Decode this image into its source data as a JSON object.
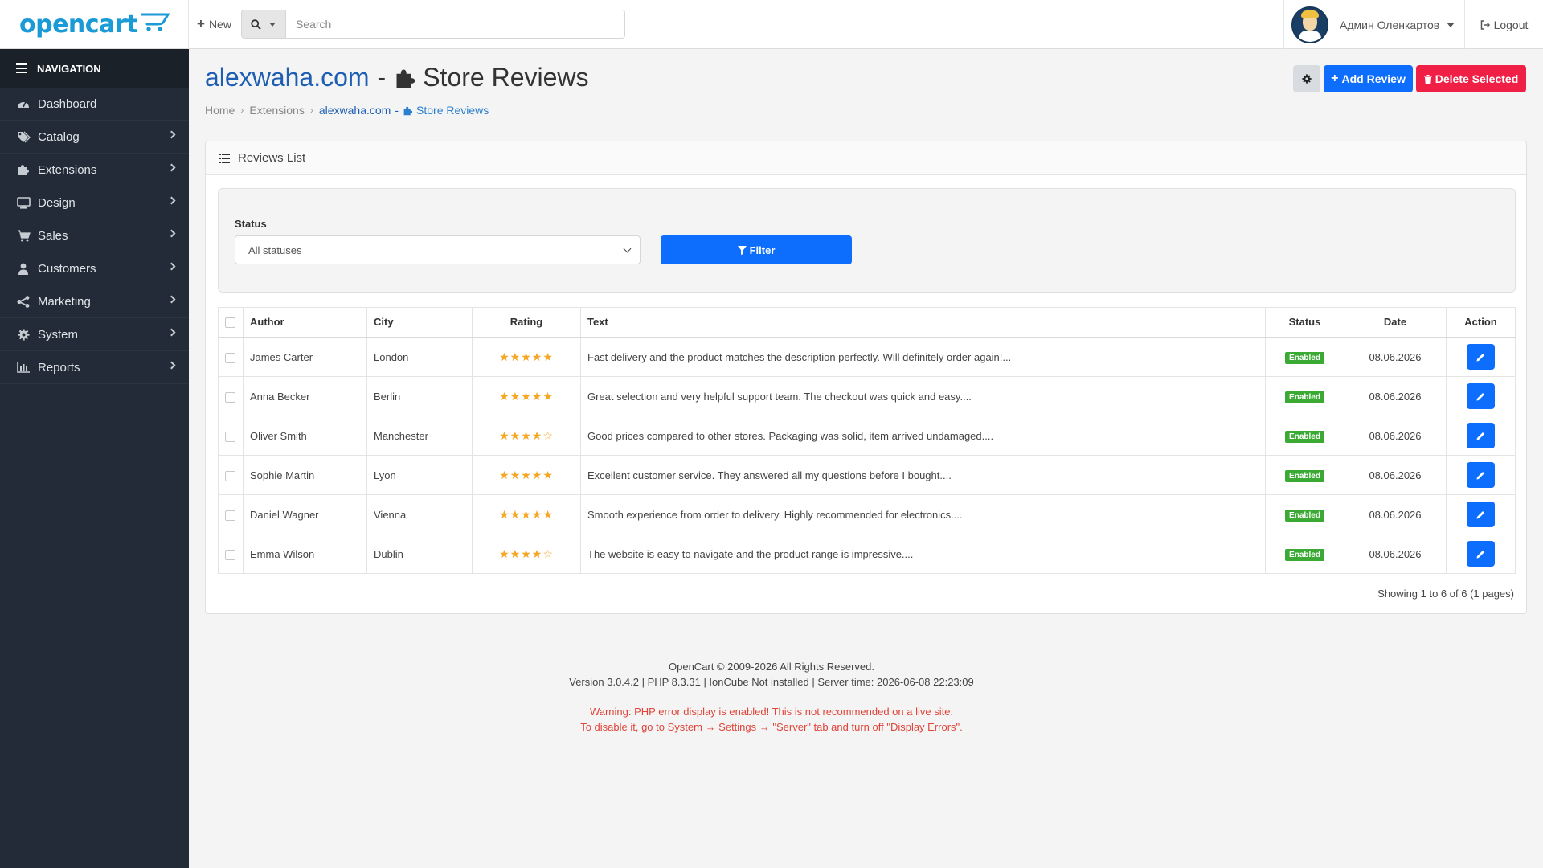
{
  "header": {
    "logo": "opencart",
    "new_label": "New",
    "search_placeholder": "Search",
    "user_name": "Админ Оленкартов",
    "logout_label": "Logout"
  },
  "sidebar": {
    "title": "NAVIGATION",
    "items": [
      {
        "label": "Dashboard",
        "icon": "dashboard-icon"
      },
      {
        "label": "Catalog",
        "icon": "tags-icon"
      },
      {
        "label": "Extensions",
        "icon": "puzzle-icon"
      },
      {
        "label": "Design",
        "icon": "desktop-icon"
      },
      {
        "label": "Sales",
        "icon": "cart-icon"
      },
      {
        "label": "Customers",
        "icon": "user-icon"
      },
      {
        "label": "Marketing",
        "icon": "share-icon"
      },
      {
        "label": "System",
        "icon": "gear-icon"
      },
      {
        "label": "Reports",
        "icon": "bar-chart-icon"
      }
    ]
  },
  "page": {
    "site": "alexwaha.com",
    "dash": "-",
    "title": "Store Reviews",
    "breadcrumb": [
      "Home",
      "Extensions",
      "alexwaha.com",
      "-",
      "Store Reviews"
    ],
    "add_label": "Add Review",
    "delete_label": "Delete Selected"
  },
  "panel": {
    "title": "Reviews List",
    "filter": {
      "status_label": "Status",
      "status_value": "All statuses",
      "filter_button": "Filter"
    },
    "table": {
      "headers": [
        "Author",
        "City",
        "Rating",
        "Text",
        "Status",
        "Date",
        "Action"
      ],
      "rows": [
        {
          "author": "James Carter",
          "city": "London",
          "rating": 5,
          "stars": "★★★★★",
          "text": "Fast delivery and the product matches the description perfectly. Will definitely order again!...",
          "status": "Enabled",
          "date": "08.06.2026"
        },
        {
          "author": "Anna Becker",
          "city": "Berlin",
          "rating": 5,
          "stars": "★★★★★",
          "text": "Great selection and very helpful support team. The checkout was quick and easy....",
          "status": "Enabled",
          "date": "08.06.2026"
        },
        {
          "author": "Oliver Smith",
          "city": "Manchester",
          "rating": 4,
          "stars": "★★★★☆",
          "text": "Good prices compared to other stores. Packaging was solid, item arrived undamaged....",
          "status": "Enabled",
          "date": "08.06.2026"
        },
        {
          "author": "Sophie Martin",
          "city": "Lyon",
          "rating": 5,
          "stars": "★★★★★",
          "text": "Excellent customer service. They answered all my questions before I bought....",
          "status": "Enabled",
          "date": "08.06.2026"
        },
        {
          "author": "Daniel Wagner",
          "city": "Vienna",
          "rating": 5,
          "stars": "★★★★★",
          "text": "Smooth experience from order to delivery. Highly recommended for electronics....",
          "status": "Enabled",
          "date": "08.06.2026"
        },
        {
          "author": "Emma Wilson",
          "city": "Dublin",
          "rating": 4,
          "stars": "★★★★☆",
          "text": "The website is easy to navigate and the product range is impressive....",
          "status": "Enabled",
          "date": "08.06.2026"
        }
      ]
    },
    "showing": "Showing 1 to 6 of 6 (1 pages)"
  },
  "footer": {
    "copyright": "OpenCart © 2009-2026 All Rights Reserved.",
    "version": "Version 3.0.4.2 | PHP 8.3.31 | IonCube Not installed | Server time: 2026-06-08 22:23:09",
    "warning1": "Warning: PHP error display is enabled! This is not recommended on a live site.",
    "warning2": "To disable it, go to System → Settings → \"Server\" tab and turn off \"Display Errors\"."
  },
  "colors": {
    "primary": "#0d6efd",
    "danger": "#f01f45",
    "sidebar": "#222b37",
    "star": "#f5a623",
    "badge": "#3aaa35",
    "link": "#1e5fb4"
  }
}
